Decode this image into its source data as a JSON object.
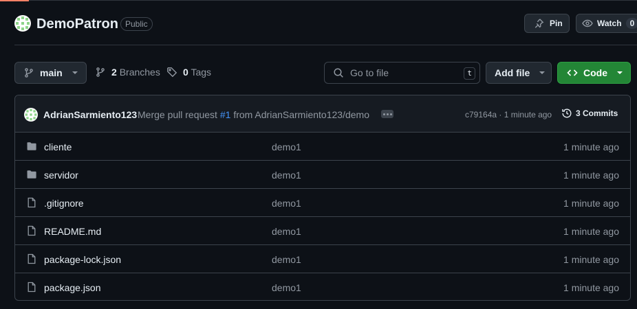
{
  "repo": {
    "name": "DemoPatron",
    "visibility": "Public",
    "pin_label": "Pin",
    "watch_label": "Watch",
    "watch_count": "0"
  },
  "toolbar": {
    "branch": "main",
    "branches_count": "2",
    "branches_label": "Branches",
    "tags_count": "0",
    "tags_label": "Tags",
    "search_placeholder": "Go to file",
    "search_shortcut": "t",
    "add_file_label": "Add file",
    "code_label": "Code"
  },
  "latest_commit": {
    "author": "AdrianSarmiento123",
    "message_prefix": "Merge pull request",
    "pr_link": "#1",
    "message_suffix": "from AdrianSarmiento123/demo",
    "hash": "c79164a",
    "time": "1 minute ago",
    "commits_label": "3 Commits"
  },
  "files": [
    {
      "type": "folder",
      "name": "cliente",
      "commit": "demo1",
      "time": "1 minute ago"
    },
    {
      "type": "folder",
      "name": "servidor",
      "commit": "demo1",
      "time": "1 minute ago"
    },
    {
      "type": "file",
      "name": ".gitignore",
      "commit": "demo1",
      "time": "1 minute ago"
    },
    {
      "type": "file",
      "name": "README.md",
      "commit": "demo1",
      "time": "1 minute ago"
    },
    {
      "type": "file",
      "name": "package-lock.json",
      "commit": "demo1",
      "time": "1 minute ago"
    },
    {
      "type": "file",
      "name": "package.json",
      "commit": "demo1",
      "time": "1 minute ago"
    }
  ],
  "colors": {
    "background": "#0d1117",
    "border": "#3d444d",
    "code_button": "#238636",
    "link": "#4493f8",
    "muted": "#9198a1"
  }
}
